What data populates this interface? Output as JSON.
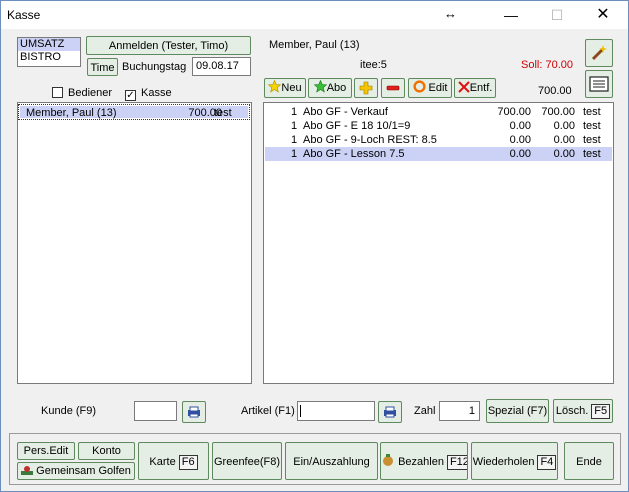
{
  "window": {
    "title": "Kasse",
    "resize_glyph": "↔",
    "min_glyph": "—",
    "max_glyph": "☐",
    "close_glyph": "✕"
  },
  "mode_list": [
    "UMSATZ",
    "BISTRO"
  ],
  "header": {
    "login_button": "Anmelden (Tester, Timo)",
    "time_button": "Time",
    "booking_day_label": "Buchungstag",
    "booking_day_value": "09.08.17",
    "member_name": "Member, Paul (13)",
    "item_count": "itee:5",
    "soll": "Soll: 70.00",
    "total": "700.00"
  },
  "filters": {
    "bediener_label": "Bediener",
    "bediener_checked": false,
    "kasse_label": "Kasse",
    "kasse_checked": true,
    "check_glyph": "✓"
  },
  "toolbar": {
    "neu": "Neu",
    "abo": "Abo",
    "edit": "Edit",
    "entf": "Entf."
  },
  "left_list": [
    {
      "name": "Member, Paul (13)",
      "amount": "700.00",
      "note": "test"
    }
  ],
  "items": [
    {
      "qty": "1",
      "name": "Abo GF - Verkauf",
      "price": "700.00",
      "total": "700.00",
      "note": "test"
    },
    {
      "qty": "1",
      "name": "Abo GF - E 18  10/1=9",
      "price": "0.00",
      "total": "0.00",
      "note": "test"
    },
    {
      "qty": "1",
      "name": "Abo GF - 9-Loch REST: 8.5",
      "price": "0.00",
      "total": "0.00",
      "note": "test"
    },
    {
      "qty": "1",
      "name": "Abo GF - Lesson 7.5",
      "price": "0.00",
      "total": "0.00",
      "note": "test"
    }
  ],
  "entry": {
    "kunde_label": "Kunde (F9)",
    "artikel_label": "Artikel (F1)",
    "zahl_label": "Zahl",
    "zahl_value": "1",
    "spezial_button": "Spezial (F7)",
    "loesch_button": "Lösch.",
    "loesch_key": "F5"
  },
  "bottom": {
    "pers_edit": "Pers.Edit",
    "konto": "Konto",
    "gemeinsam": "Gemeinsam Golfen",
    "karte": "Karte",
    "karte_key": "F6",
    "greenfee": "Greenfee(F8)",
    "einaus": "Ein/Auszahlung",
    "bezahlen": "Bezahlen",
    "bezahlen_key": "F12",
    "wiederholen": "Wiederholen",
    "wiederholen_key": "F4",
    "ende": "Ende"
  },
  "colors": {
    "soll": "#cc0000",
    "selection": "#ccd2f5",
    "button_bg": "#e4eee4",
    "button_border": "#5e8a5e"
  }
}
